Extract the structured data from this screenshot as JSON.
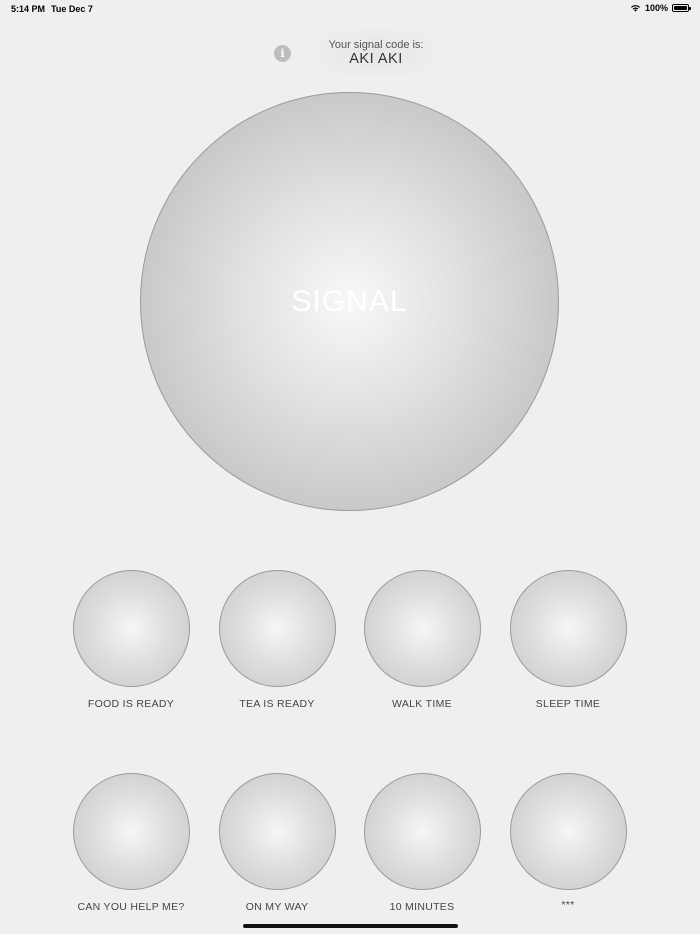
{
  "status_bar": {
    "time": "5:14 PM",
    "date": "Tue Dec 7",
    "battery": "100%"
  },
  "header": {
    "info_icon": "i",
    "code_label": "Your signal code is:",
    "code_value": "AKI AKI"
  },
  "signal": {
    "label": "SIGNAL"
  },
  "messages": [
    {
      "label": "FOOD IS READY"
    },
    {
      "label": "TEA IS READY"
    },
    {
      "label": "WALK TIME"
    },
    {
      "label": "SLEEP TIME"
    },
    {
      "label": "CAN YOU HELP ME?"
    },
    {
      "label": "ON MY WAY"
    },
    {
      "label": "10 MINUTES"
    },
    {
      "label": "***"
    }
  ]
}
